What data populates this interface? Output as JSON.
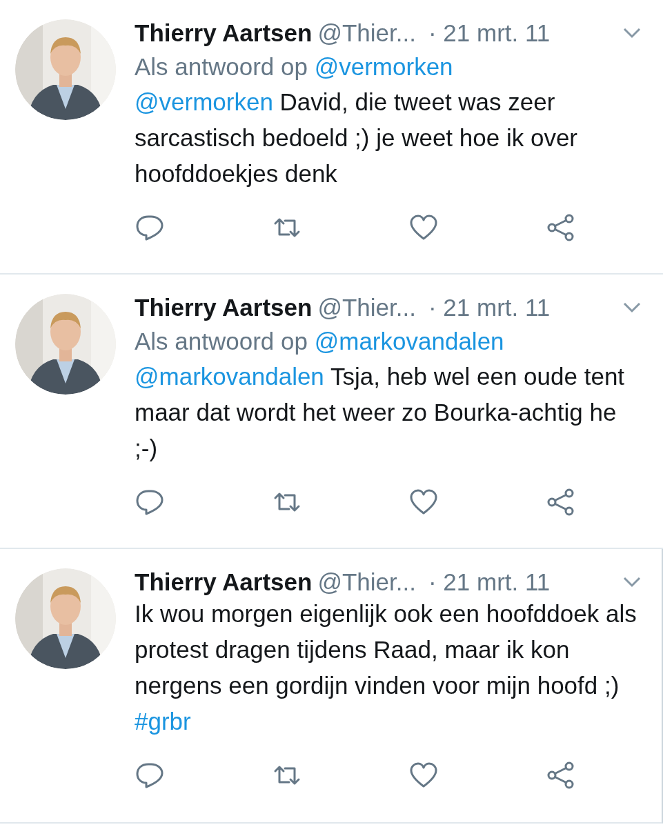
{
  "tweets": [
    {
      "name": "Thierry Aartsen",
      "handle": "@Thier...",
      "date": "· 21 mrt. 11",
      "reply_to": {
        "prefix": "Als antwoord op",
        "mention": "@vermorken"
      },
      "body": [
        {
          "kind": "mention",
          "text": "@vermorken"
        },
        {
          "kind": "text",
          "text": " David, die tweet was zeer sarcastisch bedoeld ;) je weet hoe ik over hoofddoekjes denk"
        }
      ]
    },
    {
      "name": "Thierry Aartsen",
      "handle": "@Thier...",
      "date": "· 21 mrt. 11",
      "reply_to": {
        "prefix": "Als antwoord op",
        "mention": "@markovandalen"
      },
      "body": [
        {
          "kind": "mention",
          "text": "@markovandalen"
        },
        {
          "kind": "text",
          "text": " Tsja, heb wel een oude tent maar dat wordt het weer zo Bourka-achtig he ;-)"
        }
      ]
    },
    {
      "name": "Thierry Aartsen",
      "handle": "@Thier...",
      "date": "· 21 mrt. 11",
      "body": [
        {
          "kind": "text",
          "text": "Ik wou morgen eigenlijk ook een hoofddoek als protest dragen tijdens Raad, maar ik kon nergens een gordijn vinden voor mijn hoofd ;) "
        },
        {
          "kind": "hashtag",
          "text": "#grbr"
        }
      ]
    }
  ]
}
